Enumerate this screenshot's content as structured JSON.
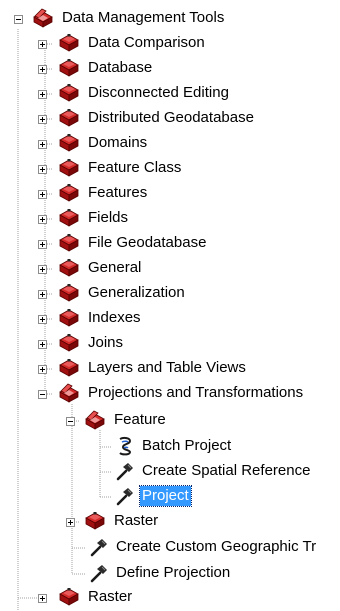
{
  "tree": {
    "root": {
      "label": "Data Management Tools",
      "icon": "toolbox-open-icon",
      "expanded": true
    },
    "toolsets": [
      {
        "label": "Data Comparison",
        "icon": "toolbox-icon"
      },
      {
        "label": "Database",
        "icon": "toolbox-icon"
      },
      {
        "label": "Disconnected Editing",
        "icon": "toolbox-icon"
      },
      {
        "label": "Distributed Geodatabase",
        "icon": "toolbox-icon"
      },
      {
        "label": "Domains",
        "icon": "toolbox-icon"
      },
      {
        "label": "Feature Class",
        "icon": "toolbox-icon"
      },
      {
        "label": "Features",
        "icon": "toolbox-icon"
      },
      {
        "label": "Fields",
        "icon": "toolbox-icon"
      },
      {
        "label": "File Geodatabase",
        "icon": "toolbox-icon"
      },
      {
        "label": "General",
        "icon": "toolbox-icon"
      },
      {
        "label": "Generalization",
        "icon": "toolbox-icon"
      },
      {
        "label": "Indexes",
        "icon": "toolbox-icon"
      },
      {
        "label": "Joins",
        "icon": "toolbox-icon"
      },
      {
        "label": "Layers and Table Views",
        "icon": "toolbox-icon"
      },
      {
        "label": "Projections and Transformations",
        "icon": "toolbox-open-icon",
        "expanded": true
      }
    ],
    "projections_children": {
      "feature": {
        "label": "Feature",
        "icon": "toolbox-open-icon",
        "expanded": true
      },
      "feature_tools": [
        {
          "label": "Batch Project",
          "icon": "script-icon"
        },
        {
          "label": "Create Spatial Reference",
          "icon": "hammer-icon"
        },
        {
          "label": "Project",
          "icon": "hammer-icon",
          "selected": true
        }
      ],
      "raster": {
        "label": "Raster",
        "icon": "toolbox-icon"
      },
      "tools": [
        {
          "label": "Create Custom Geographic Tr",
          "icon": "hammer-icon"
        },
        {
          "label": "Define Projection",
          "icon": "hammer-icon"
        }
      ]
    },
    "last": {
      "label": "Raster",
      "icon": "toolbox-icon"
    }
  },
  "colors": {
    "selection_bg": "#3399ff",
    "selection_text": "#ffffff",
    "toolbox_red": "#c0181b",
    "guide_line": "#a0a0a0"
  }
}
